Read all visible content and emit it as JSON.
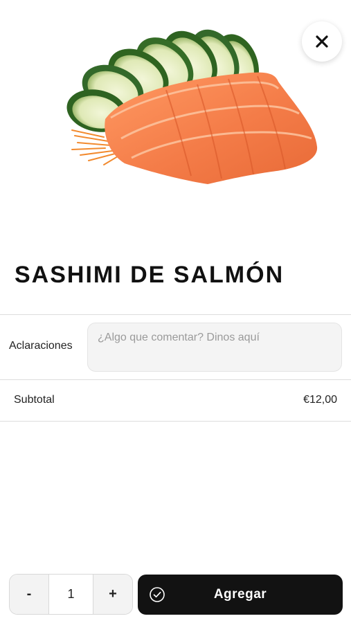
{
  "product": {
    "title": "SASHIMI DE SALMÓN",
    "image_icon": "salmon-sashimi-image"
  },
  "header": {
    "close_icon": "close-icon"
  },
  "notes": {
    "label": "Aclaraciones",
    "placeholder": "¿Algo que comentar? Dinos aquí",
    "value": ""
  },
  "summary": {
    "subtotal_label": "Subtotal",
    "subtotal_value": "€12,00"
  },
  "footer": {
    "decrement_label": "-",
    "quantity": "1",
    "increment_label": "+",
    "add_label": "Agregar",
    "add_icon": "check-circle-icon"
  },
  "colors": {
    "accent": "#121212",
    "salmon": "#f07a45",
    "cucumber": "#3f7a2c",
    "divider": "#dcdcdc"
  }
}
